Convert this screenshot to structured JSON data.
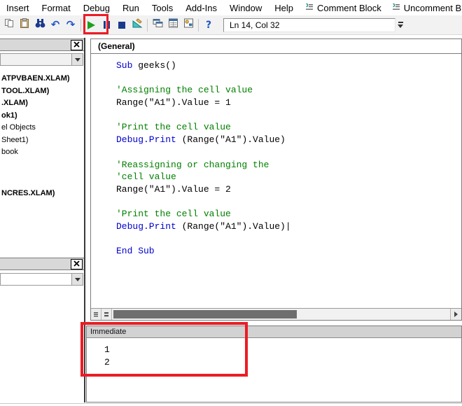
{
  "menu": {
    "items": [
      {
        "label": "Insert"
      },
      {
        "label": "Format"
      },
      {
        "label": "Debug"
      },
      {
        "label": "Run"
      },
      {
        "label": "Tools"
      },
      {
        "label": "Add-Ins"
      },
      {
        "label": "Window"
      },
      {
        "label": "Help"
      }
    ],
    "block_items": [
      {
        "label": "Comment Block",
        "icon": "comment-block-icon"
      },
      {
        "label": "Uncomment Block",
        "icon": "uncomment-block-icon"
      }
    ]
  },
  "toolbar": {
    "items": [
      {
        "name": "copy"
      },
      {
        "name": "paste"
      },
      {
        "name": "find"
      },
      {
        "name": "undo"
      },
      {
        "name": "redo"
      },
      {
        "separator": true
      },
      {
        "name": "run",
        "highlighted": true
      },
      {
        "name": "break"
      },
      {
        "name": "reset"
      },
      {
        "name": "design-mode"
      },
      {
        "separator": true
      },
      {
        "name": "project-explorer"
      },
      {
        "name": "properties-window"
      },
      {
        "name": "object-browser"
      },
      {
        "separator": true
      },
      {
        "name": "help"
      }
    ],
    "line_col_status": "Ln 14, Col 32"
  },
  "project_explorer": {
    "items": [
      {
        "label": "ATPVBAEN.XLAM)",
        "bold": true
      },
      {
        "label": "TOOL.XLAM)",
        "bold": true
      },
      {
        "label": ".XLAM)",
        "bold": true
      },
      {
        "label": "ok1)",
        "bold": true
      },
      {
        "label": "el Objects",
        "bold": false
      },
      {
        "label": "Sheet1)",
        "bold": false
      },
      {
        "label": "book",
        "bold": false
      },
      {
        "label": "NCRES.XLAM)",
        "bold": true,
        "gap_before": true
      }
    ]
  },
  "code_window": {
    "scope_dropdown": "(General)",
    "lines": [
      [
        {
          "t": "Sub",
          "y": "k"
        },
        {
          "t": " geeks()",
          "y": "n"
        }
      ],
      [],
      [
        {
          "t": "'Assigning the cell value",
          "y": "c"
        }
      ],
      [
        {
          "t": "Range(\"A1\").Value = 1",
          "y": "n"
        }
      ],
      [],
      [
        {
          "t": "'Print the cell value",
          "y": "c"
        }
      ],
      [
        {
          "t": "Debug.Print",
          "y": "k"
        },
        {
          "t": " (Range(\"A1\").Value)",
          "y": "n"
        }
      ],
      [],
      [
        {
          "t": "'Reassigning or changing the",
          "y": "c"
        }
      ],
      [
        {
          "t": "'cell value",
          "y": "c"
        }
      ],
      [
        {
          "t": "Range(\"A1\").Value = 2",
          "y": "n"
        }
      ],
      [],
      [
        {
          "t": "'Print the cell value",
          "y": "c"
        }
      ],
      [
        {
          "t": "Debug.Print",
          "y": "k"
        },
        {
          "t": " (Range(\"A1\").Value)",
          "y": "n"
        },
        {
          "t": "|",
          "y": "caret"
        }
      ],
      [],
      [
        {
          "t": "End Sub",
          "y": "k"
        }
      ]
    ]
  },
  "immediate_window": {
    "title": "Immediate",
    "output_lines": [
      "1",
      "2"
    ]
  },
  "colors": {
    "comment": "#008000",
    "keyword": "#0000cd",
    "highlight_box": "#ec1c24",
    "run_button": "#1fa11f"
  }
}
